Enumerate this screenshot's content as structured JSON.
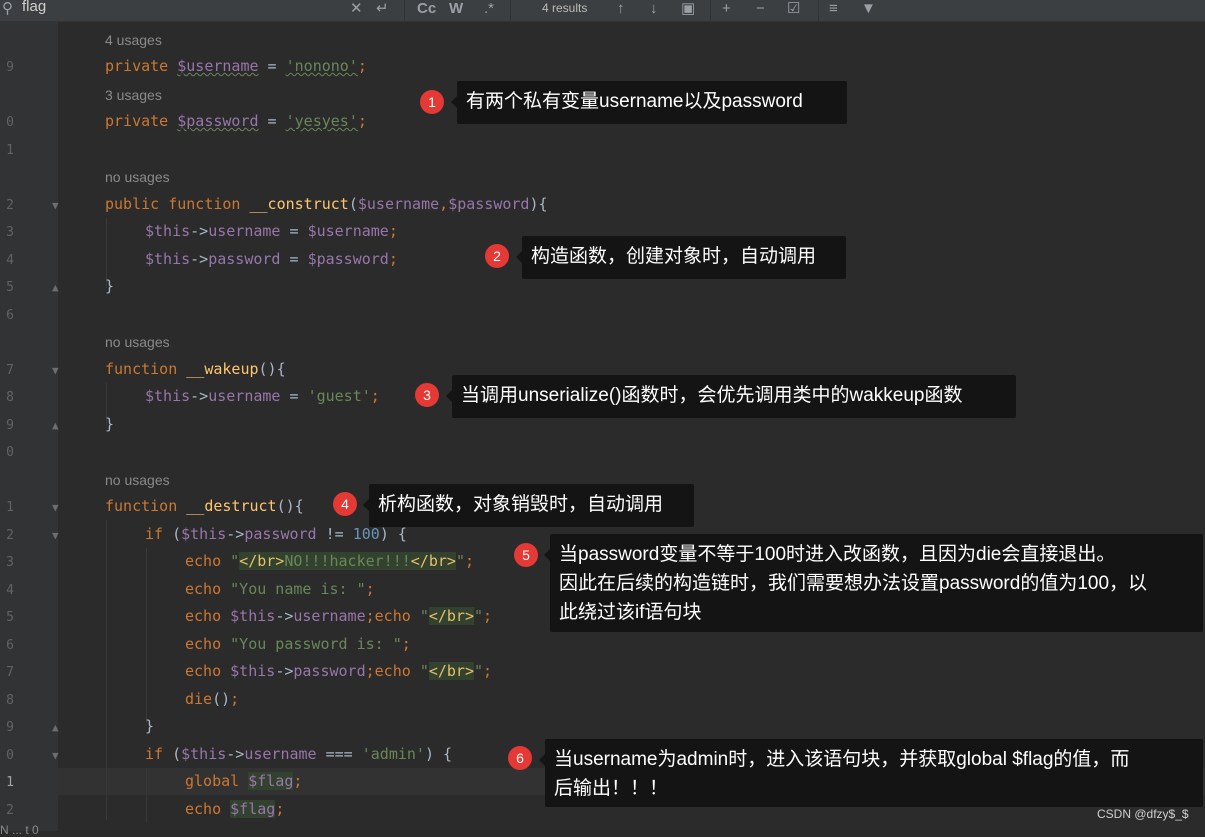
{
  "find_bar": {
    "search_icon": "search-icon",
    "query": "flag",
    "match_case": "Cc",
    "whole_word": "W",
    "regex": ".*",
    "results": "4 results"
  },
  "gutter": {
    "line_numbers": [
      "9",
      "0",
      "1",
      "2",
      "3",
      "4",
      "5",
      "6",
      "7",
      "8",
      "9",
      "0",
      "1",
      "2",
      "3",
      "4",
      "5",
      "6",
      "7",
      "8",
      "9",
      "0",
      "1",
      "2"
    ]
  },
  "code": {
    "hint_4_usages": "4 usages",
    "hint_3_usages": "3 usages",
    "hint_no_usages": "no usages",
    "private": "private",
    "public": "public",
    "function": "function",
    "if": "if",
    "echo": "echo",
    "global": "global",
    "var_username": "$username",
    "var_password": "$password",
    "var_this": "$this",
    "var_flag": "$flag",
    "str_nonono": "'nonono'",
    "str_yesyes": "'yesyes'",
    "str_guest": "'guest'",
    "str_admin": "'admin'",
    "fn_construct": "__construct",
    "fn_wakeup": "__wakeup",
    "fn_destruct": "__destruct",
    "fn_die": "die",
    "prop_username": "username",
    "prop_password": "password",
    "num_100": "100",
    "tag_br_open": "</br>",
    "tag_br_close": "</br>",
    "str_hacker": "NO!!!hacker!!!",
    "str_name_is": "\"You name is: \"",
    "str_password_is": "\"You password is: \""
  },
  "annotations": [
    {
      "num": "1",
      "text": "有两个私有变量username以及password"
    },
    {
      "num": "2",
      "text": "构造函数，创建对象时，自动调用"
    },
    {
      "num": "3",
      "text": "当调用unserialize()函数时，会优先调用类中的wakkeup函数"
    },
    {
      "num": "4",
      "text": "析构函数，对象销毁时，自动调用"
    },
    {
      "num": "5",
      "text_lines": [
        "当password变量不等于100时进入改函数，且因为die会直接退出。",
        "因此在后续的构造链时，我们需要想办法设置password的值为100，以",
        "此绕过该if语句块"
      ]
    },
    {
      "num": "6",
      "text_lines": [
        "当username为admin时，进入该语句块，并获取global $flag的值，而",
        "后输出！！！"
      ]
    }
  ],
  "watermark": "CSDN @dfzy$_$",
  "status_fragment": "N ... t 0"
}
